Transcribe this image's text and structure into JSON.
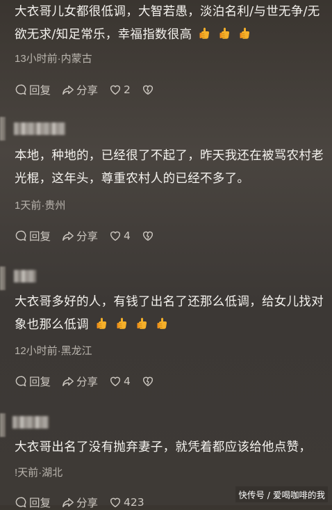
{
  "comments": [
    {
      "text": "大衣哥儿女都很低调，大智若愚，淡泊名利/与世无争/无欲无求/知足常乐，幸福指数很高",
      "emoji_count": 3,
      "meta": "13小时前·内蒙古",
      "reply_label": "回复",
      "share_label": "分享",
      "like_count": "2"
    },
    {
      "text": "本地，种地的，已经很了不起了，昨天我还在被骂农村老光棍，这年头，尊重农村人的已经不多了。",
      "emoji_count": 0,
      "meta": "1天前·贵州",
      "reply_label": "回复",
      "share_label": "分享",
      "like_count": "4"
    },
    {
      "text": "大衣哥多好的人，有钱了出名了还那么低调，给女儿找对象也那么低调",
      "emoji_count": 4,
      "meta": "12小时前·黑龙江",
      "reply_label": "回复",
      "share_label": "分享",
      "like_count": "4"
    },
    {
      "text": "大衣哥出名了没有抛弃妻子，就凭着都应该给他点赞，",
      "emoji_count": 0,
      "meta": "!天前·湖北",
      "reply_label": "回复",
      "share_label": "分享",
      "like_count": "423"
    }
  ],
  "watermark": "快传号 / 爱喝咖啡的我",
  "emoji_icon": "thumbs-up-emoji",
  "colors": {
    "background": "#3f3a35",
    "text": "#f4f2ee",
    "meta": "#b9b4ad"
  }
}
